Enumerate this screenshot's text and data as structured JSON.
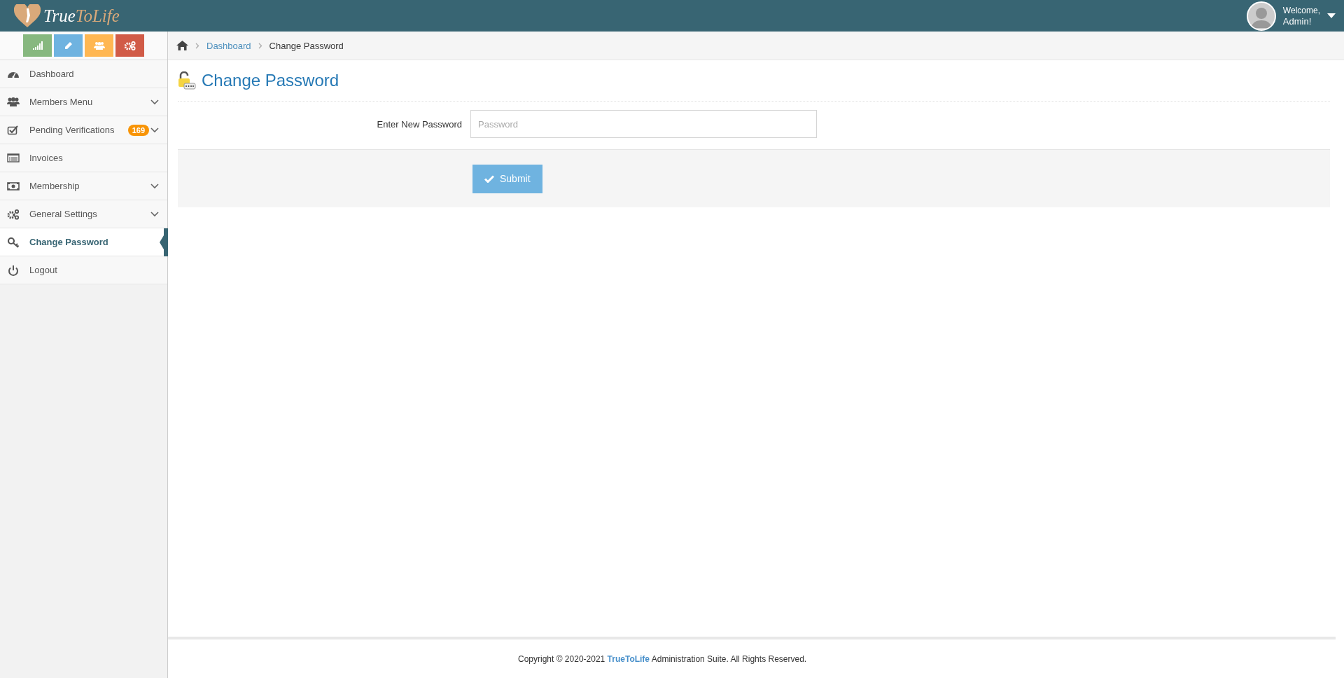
{
  "header": {
    "logo_first": "True",
    "logo_second": "ToLife",
    "welcome": "Welcome,",
    "user": "Admin!"
  },
  "shortcuts": [
    {
      "color": "#87b87f"
    },
    {
      "color": "#6fb3e0"
    },
    {
      "color": "#ffb752"
    },
    {
      "color": "#d15b47"
    }
  ],
  "sidebar": {
    "items": [
      {
        "label": "Dashboard",
        "has_submenu": false,
        "selected": false
      },
      {
        "label": "Members Menu",
        "has_submenu": true,
        "selected": false
      },
      {
        "label": "Pending Verifications",
        "badge": "169",
        "has_submenu": true,
        "selected": false
      },
      {
        "label": "Invoices",
        "has_submenu": false,
        "selected": false
      },
      {
        "label": "Membership",
        "has_submenu": true,
        "selected": false
      },
      {
        "label": "General Settings",
        "has_submenu": true,
        "selected": false
      },
      {
        "label": "Change Password",
        "has_submenu": false,
        "selected": true
      },
      {
        "label": "Logout",
        "has_submenu": false,
        "selected": false
      }
    ]
  },
  "breadcrumb": [
    {
      "label": "Dashboard",
      "kind": "link"
    },
    {
      "label": "Change Password",
      "kind": "current"
    }
  ],
  "page_title": "Change Password",
  "form": {
    "label": "Enter New Password",
    "placeholder": "Password",
    "submit": "Submit"
  },
  "footer": "Copyright © 2020-2021 **TrueToLife** Administration Suite. All Rights Reserved."
}
